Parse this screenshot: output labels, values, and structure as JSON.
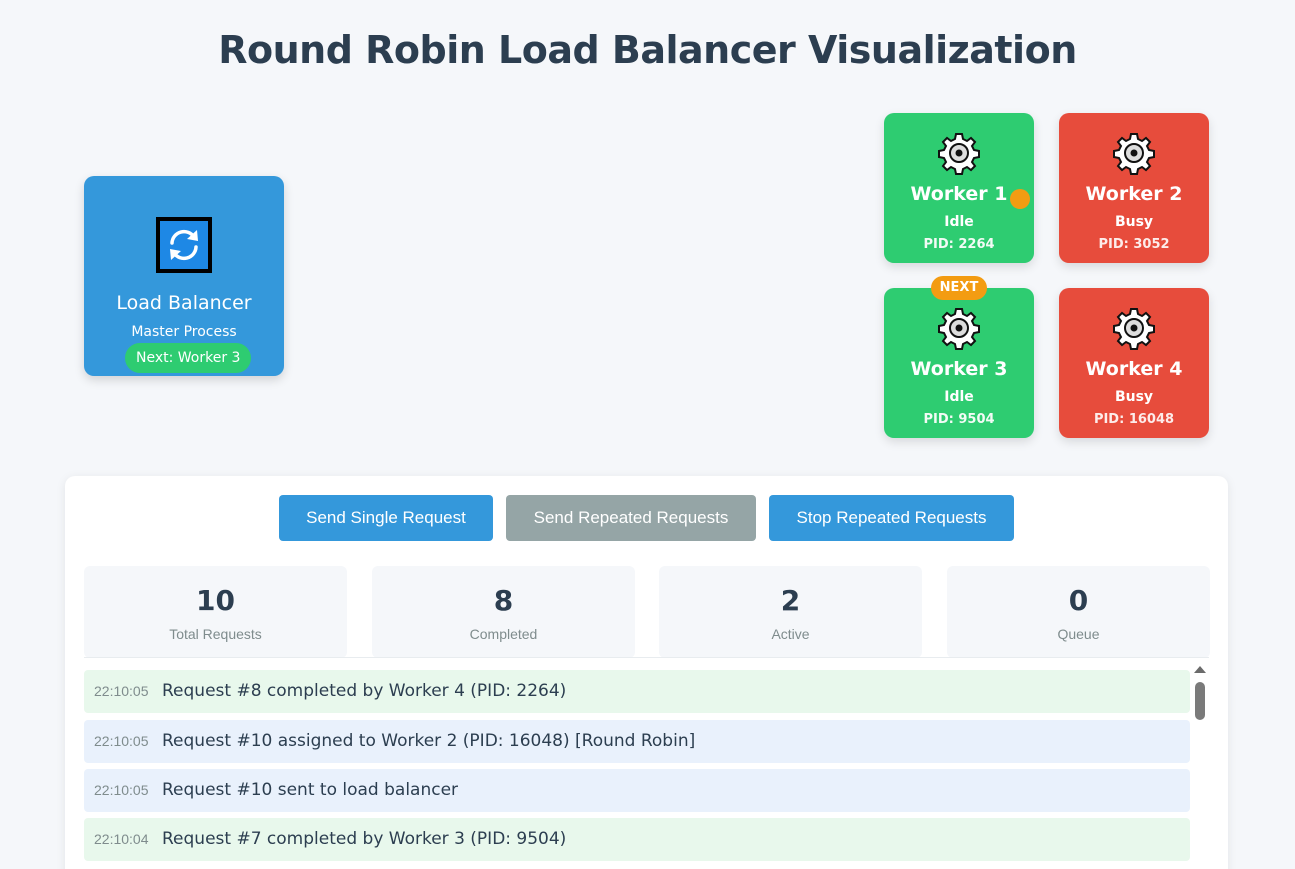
{
  "title": "Round Robin Load Balancer Visualization",
  "load_balancer": {
    "title": "Load Balancer",
    "subtitle": "Master Process",
    "next": "Next: Worker 3",
    "icon": "refresh-icon",
    "color": "#3498db"
  },
  "workers": [
    {
      "name": "Worker 1",
      "status": "Idle",
      "pid": "PID: 2264",
      "state": "idle"
    },
    {
      "name": "Worker 2",
      "status": "Busy",
      "pid": "PID: 3052",
      "state": "busy"
    },
    {
      "name": "Worker 3",
      "status": "Idle",
      "pid": "PID: 9504",
      "state": "idle",
      "badge": "NEXT"
    },
    {
      "name": "Worker 4",
      "status": "Busy",
      "pid": "PID: 16048",
      "state": "busy"
    }
  ],
  "colors": {
    "idle": "#2ecc71",
    "busy": "#e74c3c",
    "accent": "#f39c12",
    "primary": "#3498db",
    "disabled": "#95a5a6"
  },
  "controls": {
    "send_single": "Send Single Request",
    "send_repeated": "Send Repeated Requests",
    "stop_repeated": "Stop Repeated Requests"
  },
  "stats": [
    {
      "value": "10",
      "label": "Total Requests"
    },
    {
      "value": "8",
      "label": "Completed"
    },
    {
      "value": "2",
      "label": "Active"
    },
    {
      "value": "0",
      "label": "Queue"
    }
  ],
  "log": [
    {
      "time": "22:10:05",
      "message": "Request #8 completed by Worker 4 (PID: 2264)",
      "type": "success"
    },
    {
      "time": "22:10:05",
      "message": "Request #10 assigned to Worker 2 (PID: 16048) [Round Robin]",
      "type": "info"
    },
    {
      "time": "22:10:05",
      "message": "Request #10 sent to load balancer",
      "type": "info"
    },
    {
      "time": "22:10:04",
      "message": "Request #7 completed by Worker 3 (PID: 9504)",
      "type": "success"
    }
  ]
}
